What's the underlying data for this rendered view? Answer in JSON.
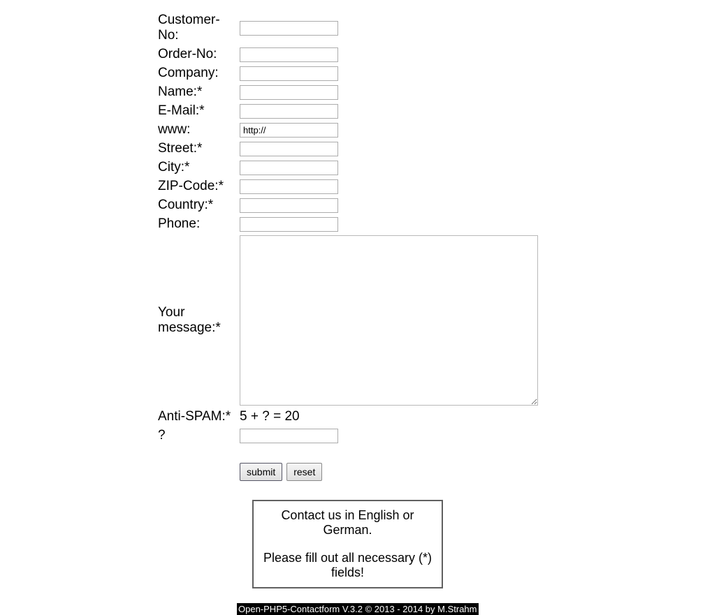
{
  "form": {
    "customer_no": {
      "label": "Customer-No:",
      "value": ""
    },
    "order_no": {
      "label": "Order-No:",
      "value": ""
    },
    "company": {
      "label": "Company:",
      "value": ""
    },
    "name": {
      "label": "Name:*",
      "value": ""
    },
    "email": {
      "label": "E-Mail:*",
      "value": ""
    },
    "www": {
      "label": "www:",
      "value": "http://"
    },
    "street": {
      "label": "Street:*",
      "value": ""
    },
    "city": {
      "label": "City:*",
      "value": ""
    },
    "zip": {
      "label": "ZIP-Code:*",
      "value": ""
    },
    "country": {
      "label": "Country:*",
      "value": ""
    },
    "phone": {
      "label": "Phone:",
      "value": ""
    },
    "message": {
      "label": "Your message:*",
      "value": ""
    },
    "antispam": {
      "label": "Anti-SPAM:*",
      "equation": "5 + ? =  20"
    },
    "question": {
      "label": "?",
      "value": ""
    }
  },
  "buttons": {
    "submit": "submit",
    "reset": "reset"
  },
  "info": {
    "line1": "Contact us in English or German.",
    "line2": "Please fill out all necessary (*) fields!"
  },
  "footer": "Open-PHP5-Contactform V.3.2 © 2013 - 2014 by M.Strahm"
}
